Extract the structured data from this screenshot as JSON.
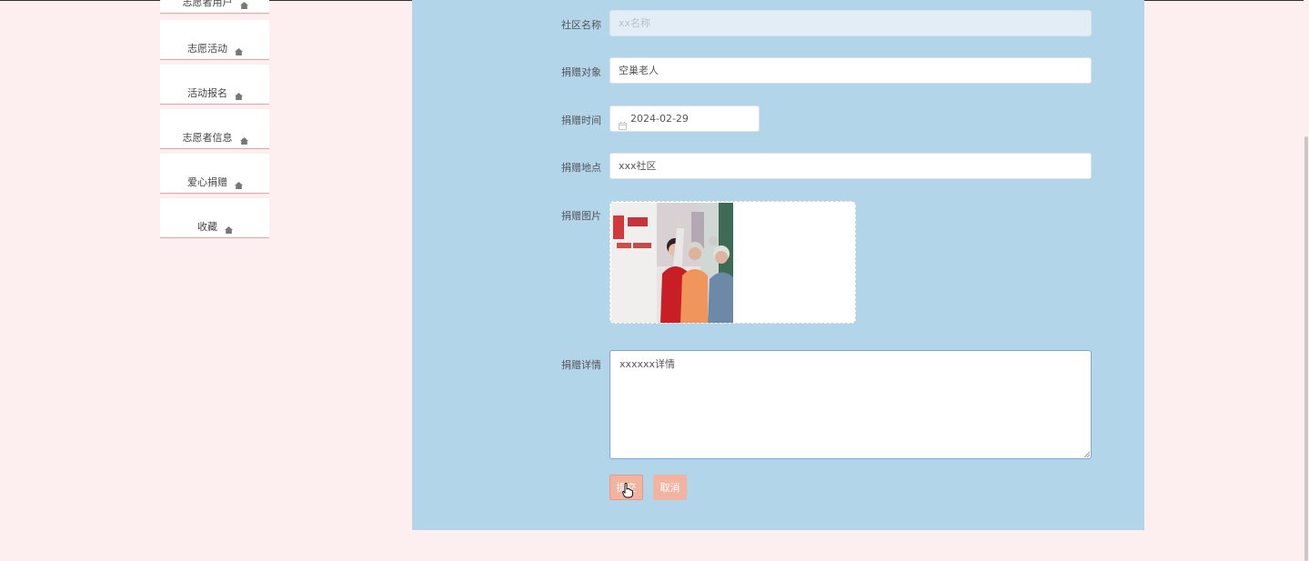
{
  "sidebar": {
    "items": [
      {
        "label": "志愿者用户",
        "icon": "home-icon"
      },
      {
        "label": "志愿活动",
        "icon": "home-icon"
      },
      {
        "label": "活动报名",
        "icon": "home-icon"
      },
      {
        "label": "志愿者信息",
        "icon": "home-icon"
      },
      {
        "label": "爱心捐赠",
        "icon": "home-icon"
      },
      {
        "label": "收藏",
        "icon": "home-icon"
      }
    ]
  },
  "form": {
    "community_name": {
      "label": "社区名称",
      "placeholder": "xx名称"
    },
    "donation_target": {
      "label": "捐赠对象",
      "value": "空巢老人"
    },
    "donation_time": {
      "label": "捐赠时间",
      "value": "2024-02-29",
      "icon": "calendar-icon"
    },
    "donation_place": {
      "label": "捐赠地点",
      "value": "xxx社区"
    },
    "donation_image": {
      "label": "捐赠图片"
    },
    "donation_detail": {
      "label": "捐赠详情",
      "value": "xxxxxx详情"
    },
    "submit_label": "提交",
    "cancel_label": "取消"
  },
  "colors": {
    "page_bg": "#fdeef0",
    "panel_bg": "#b3d5ea",
    "button_bg": "#f2b3a0",
    "sidebar_border": "#f0a0a0"
  }
}
